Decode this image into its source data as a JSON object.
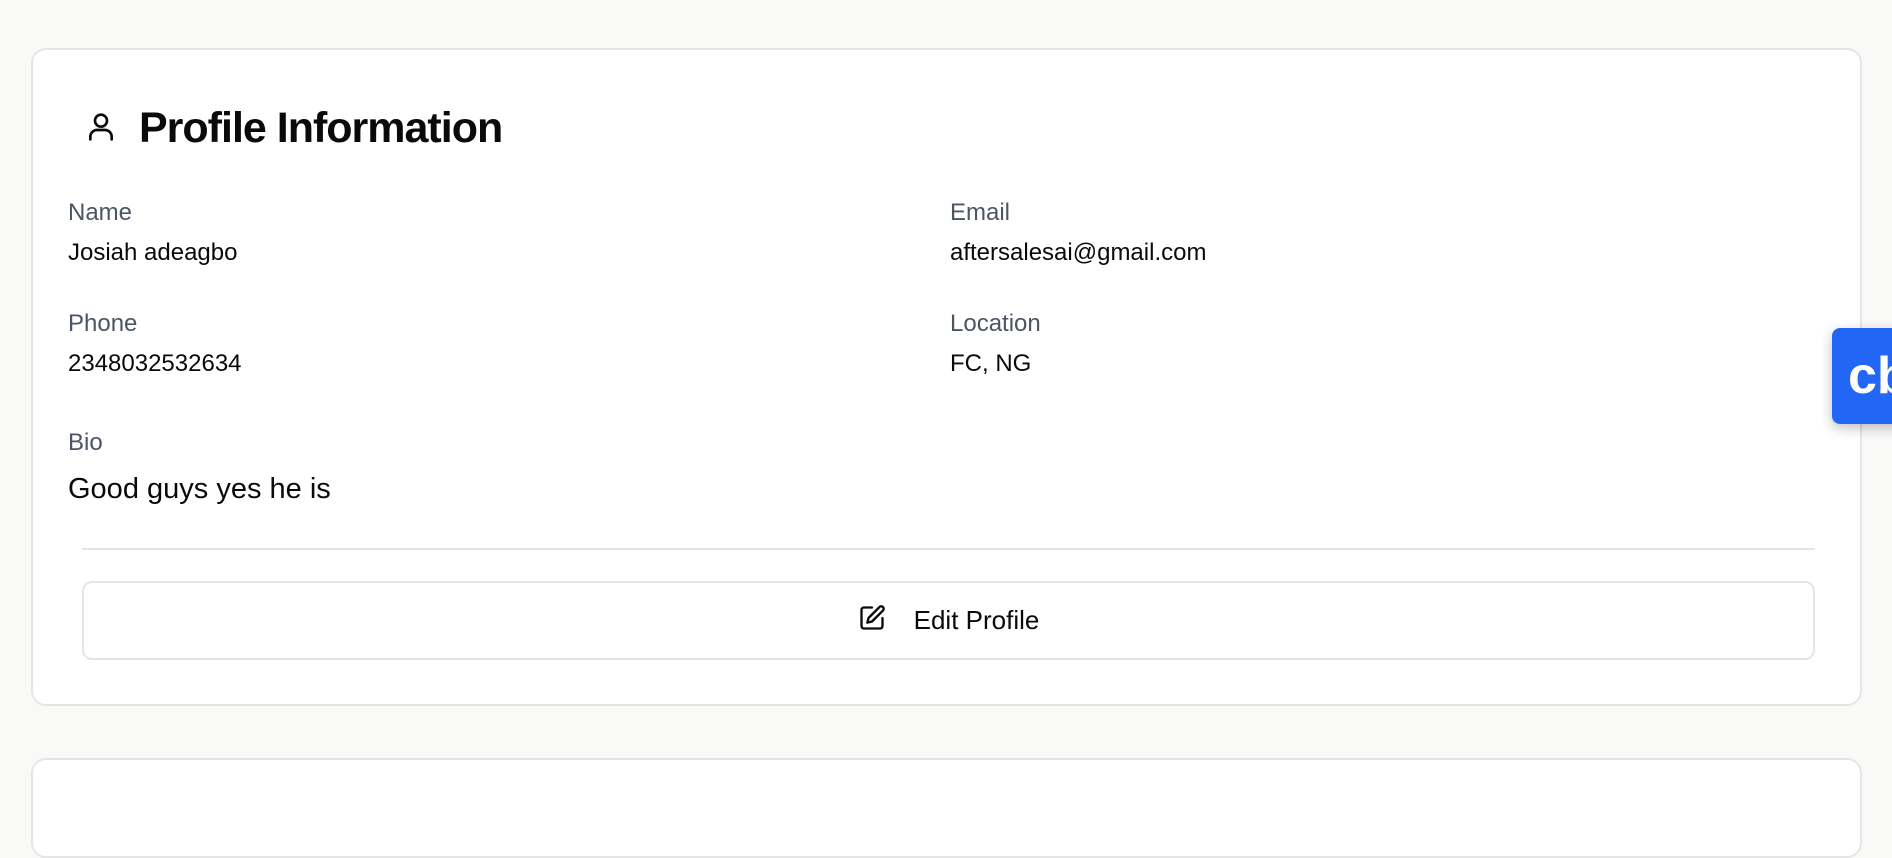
{
  "profile": {
    "title": "Profile Information",
    "fields": {
      "name": {
        "label": "Name",
        "value": "Josiah adeagbo"
      },
      "email": {
        "label": "Email",
        "value": "aftersalesai@gmail.com"
      },
      "phone": {
        "label": "Phone",
        "value": "2348032532634"
      },
      "location": {
        "label": "Location",
        "value": "FC, NG"
      },
      "bio": {
        "label": "Bio",
        "value": "Good guys yes he is"
      }
    },
    "edit_label": "Edit Profile"
  },
  "widget": {
    "label": "cb",
    "color": "#2166f5"
  }
}
